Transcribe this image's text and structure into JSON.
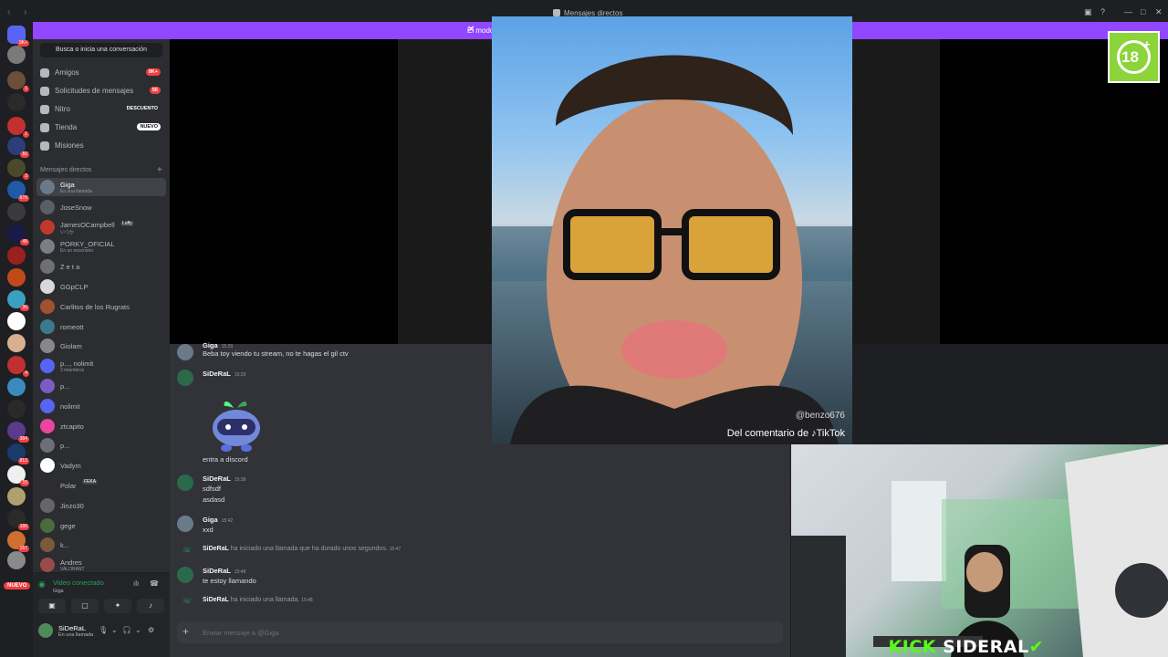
{
  "titlebar": {
    "title": "Mensajes directos",
    "nav": "‹ ›",
    "min": "—",
    "max": "□",
    "close": "✕"
  },
  "promo": {
    "text": "El modo",
    "close": "✕"
  },
  "servers": {
    "nuevo_label": "NUEVO"
  },
  "sidebar": {
    "search_label": "Busca o inicia una conversación",
    "nav": [
      {
        "label": "Amigos",
        "pill": "9K+",
        "icon": "friends-icon"
      },
      {
        "label": "Solicitudes de mensajes",
        "pill": "56",
        "icon": "envelope-icon"
      },
      {
        "label": "Nitro",
        "pill": "DESCUENTO",
        "icon": "nitro-icon"
      },
      {
        "label": "Tienda",
        "pill": "NUEVO",
        "icon": "shop-icon"
      },
      {
        "label": "Misiones",
        "pill": "",
        "icon": "quest-icon"
      }
    ],
    "dm_header": "Mensajes directos",
    "dm_add": "+",
    "dms": [
      {
        "name": "Giga",
        "sub": "En una llamada",
        "color": "#6b7a88"
      },
      {
        "name": "JoseSnow",
        "sub": "",
        "color": "#5a5e66"
      },
      {
        "name": "JamesOCampbell",
        "sub": "いつか",
        "color": "#c0392b"
      },
      {
        "name": "PORKY_OFICIAL",
        "sub": "En un escenario",
        "color": "#7a7f86"
      },
      {
        "name": "Z e t a",
        "sub": "",
        "color": "#707070"
      },
      {
        "name": "GGpCLP",
        "sub": "",
        "color": "#d8d8d8"
      },
      {
        "name": "Carlitos de los Rugrats",
        "sub": "",
        "color": "#a0522d"
      },
      {
        "name": "romeott",
        "sub": "",
        "color": "#3b7a8c"
      },
      {
        "name": "Giolam",
        "sub": "",
        "color": "#888888"
      },
      {
        "name": "p..., nolimit",
        "sub": "3 miembros",
        "color": "#5865f2"
      },
      {
        "name": "p...",
        "sub": "",
        "color": "#7b5cc4"
      },
      {
        "name": "nolimit",
        "sub": "",
        "color": "#5865f2"
      },
      {
        "name": "ztcapito",
        "sub": "",
        "color": "#eb459e"
      },
      {
        "name": "p...",
        "sub": "",
        "color": "#6d6f78"
      },
      {
        "name": "Vadym",
        "sub": "",
        "color": "#ffffff"
      },
      {
        "name": "Polar",
        "sub": "",
        "color": "#2d2d2d"
      },
      {
        "name": "Jinzo30",
        "sub": "",
        "color": "#666666"
      },
      {
        "name": "gege",
        "sub": "",
        "color": "#4a6b3a"
      },
      {
        "name": "k...",
        "sub": "",
        "color": "#7a5a3a"
      },
      {
        "name": "Andres",
        "sub": "VALORANT",
        "color": "#9a4a4a"
      }
    ],
    "dm_tags": {
      "james": "Luffy",
      "polar": "FEKA"
    },
    "voice": {
      "status": "Video conectado",
      "channel": "Giga"
    },
    "user": {
      "name": "SiDeRaL",
      "status": "En una llamada"
    }
  },
  "chat": {
    "messages": [
      {
        "author": "Giga",
        "time": "15:29",
        "lines": [
          "Beba toy viendo tu stream, no te hagas el gil ctv"
        ]
      },
      {
        "author": "SiDeRaL",
        "time": "15:29",
        "lines": [
          "entra a discord"
        ]
      },
      {
        "author": "SiDeRaL",
        "time": "15:38",
        "lines": [
          "sdfsdf",
          "asdasd"
        ]
      },
      {
        "author": "Giga",
        "time": "15:42",
        "lines": [
          "xxd"
        ]
      },
      {
        "author": "SiDeRaL",
        "time": "15:48",
        "lines": [
          "te estoy llamando"
        ]
      }
    ],
    "system": [
      {
        "author": "SiDeRaL",
        "text": "ha iniciado una llamada que ha durado unos segundos.",
        "time": "15:47"
      },
      {
        "author": "SiDeRaL",
        "text": "ha iniciado una llamada.",
        "time": "15:48"
      }
    ],
    "input_placeholder": "Enviar mensaje a @Giga",
    "input_plus": "+"
  },
  "overlay": {
    "tiktok_handle": "@benzo676",
    "tiktok_caption": "Del comentario de ♪TikTok",
    "kick_k": "KICK",
    "kick_s": "SIDERAL",
    "kick_check": "✔",
    "age_badge": "18",
    "age_plus": "+"
  }
}
